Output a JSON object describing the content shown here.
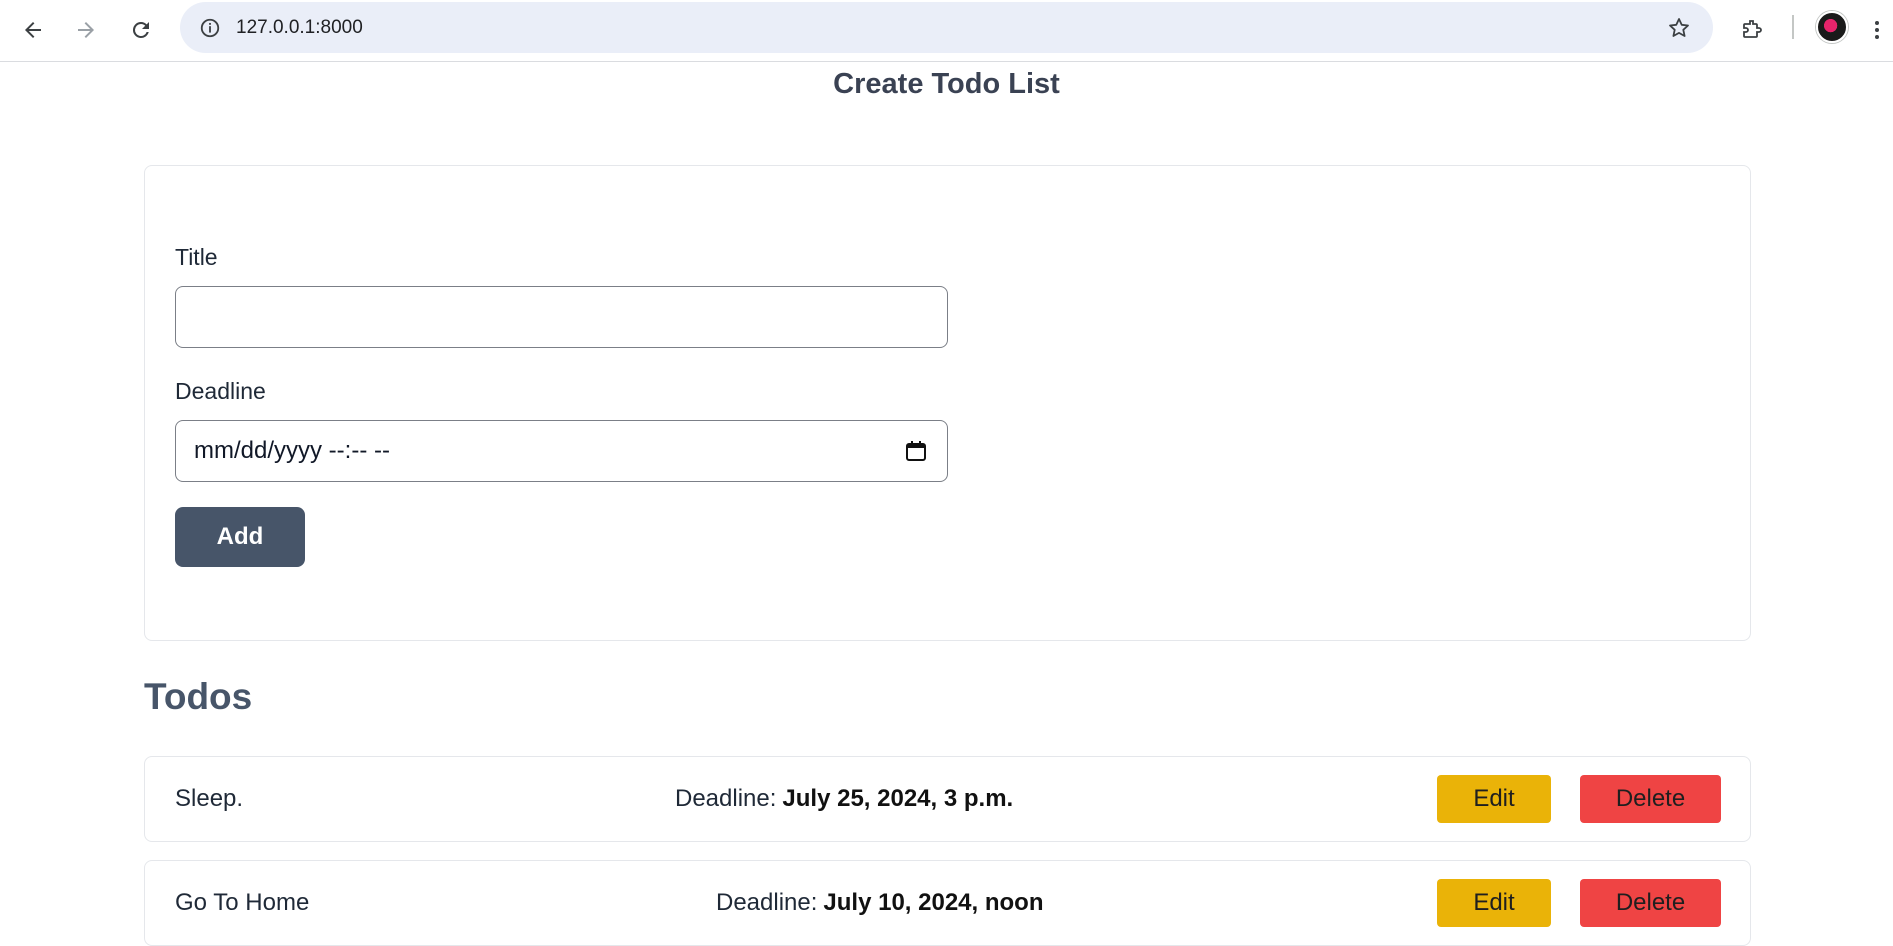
{
  "browser": {
    "url": "127.0.0.1:8000",
    "icons": [
      "back-icon",
      "forward-icon",
      "reload-icon",
      "site-info-icon",
      "bookmark-star-icon",
      "extensions-icon",
      "profile-avatar",
      "more-menu-icon"
    ]
  },
  "page": {
    "title": "Create Todo List"
  },
  "form": {
    "title_label": "Title",
    "title_value": "",
    "deadline_label": "Deadline",
    "deadline_placeholder": "mm/dd/yyyy --:-- --",
    "add_label": "Add"
  },
  "todos": {
    "heading": "Todos",
    "items": [
      {
        "title": "Sleep.",
        "deadline_label": "Deadline:",
        "deadline_value": "July 25, 2024, 3 p.m.",
        "edit_label": "Edit",
        "delete_label": "Delete"
      },
      {
        "title": "Go To Home",
        "deadline_label": "Deadline:",
        "deadline_value": "July 10, 2024, noon",
        "edit_label": "Edit",
        "delete_label": "Delete"
      }
    ]
  },
  "colors": {
    "add_button": "#475569",
    "edit_button": "#eab308",
    "delete_button": "#ef4444",
    "heading": "#475569"
  }
}
